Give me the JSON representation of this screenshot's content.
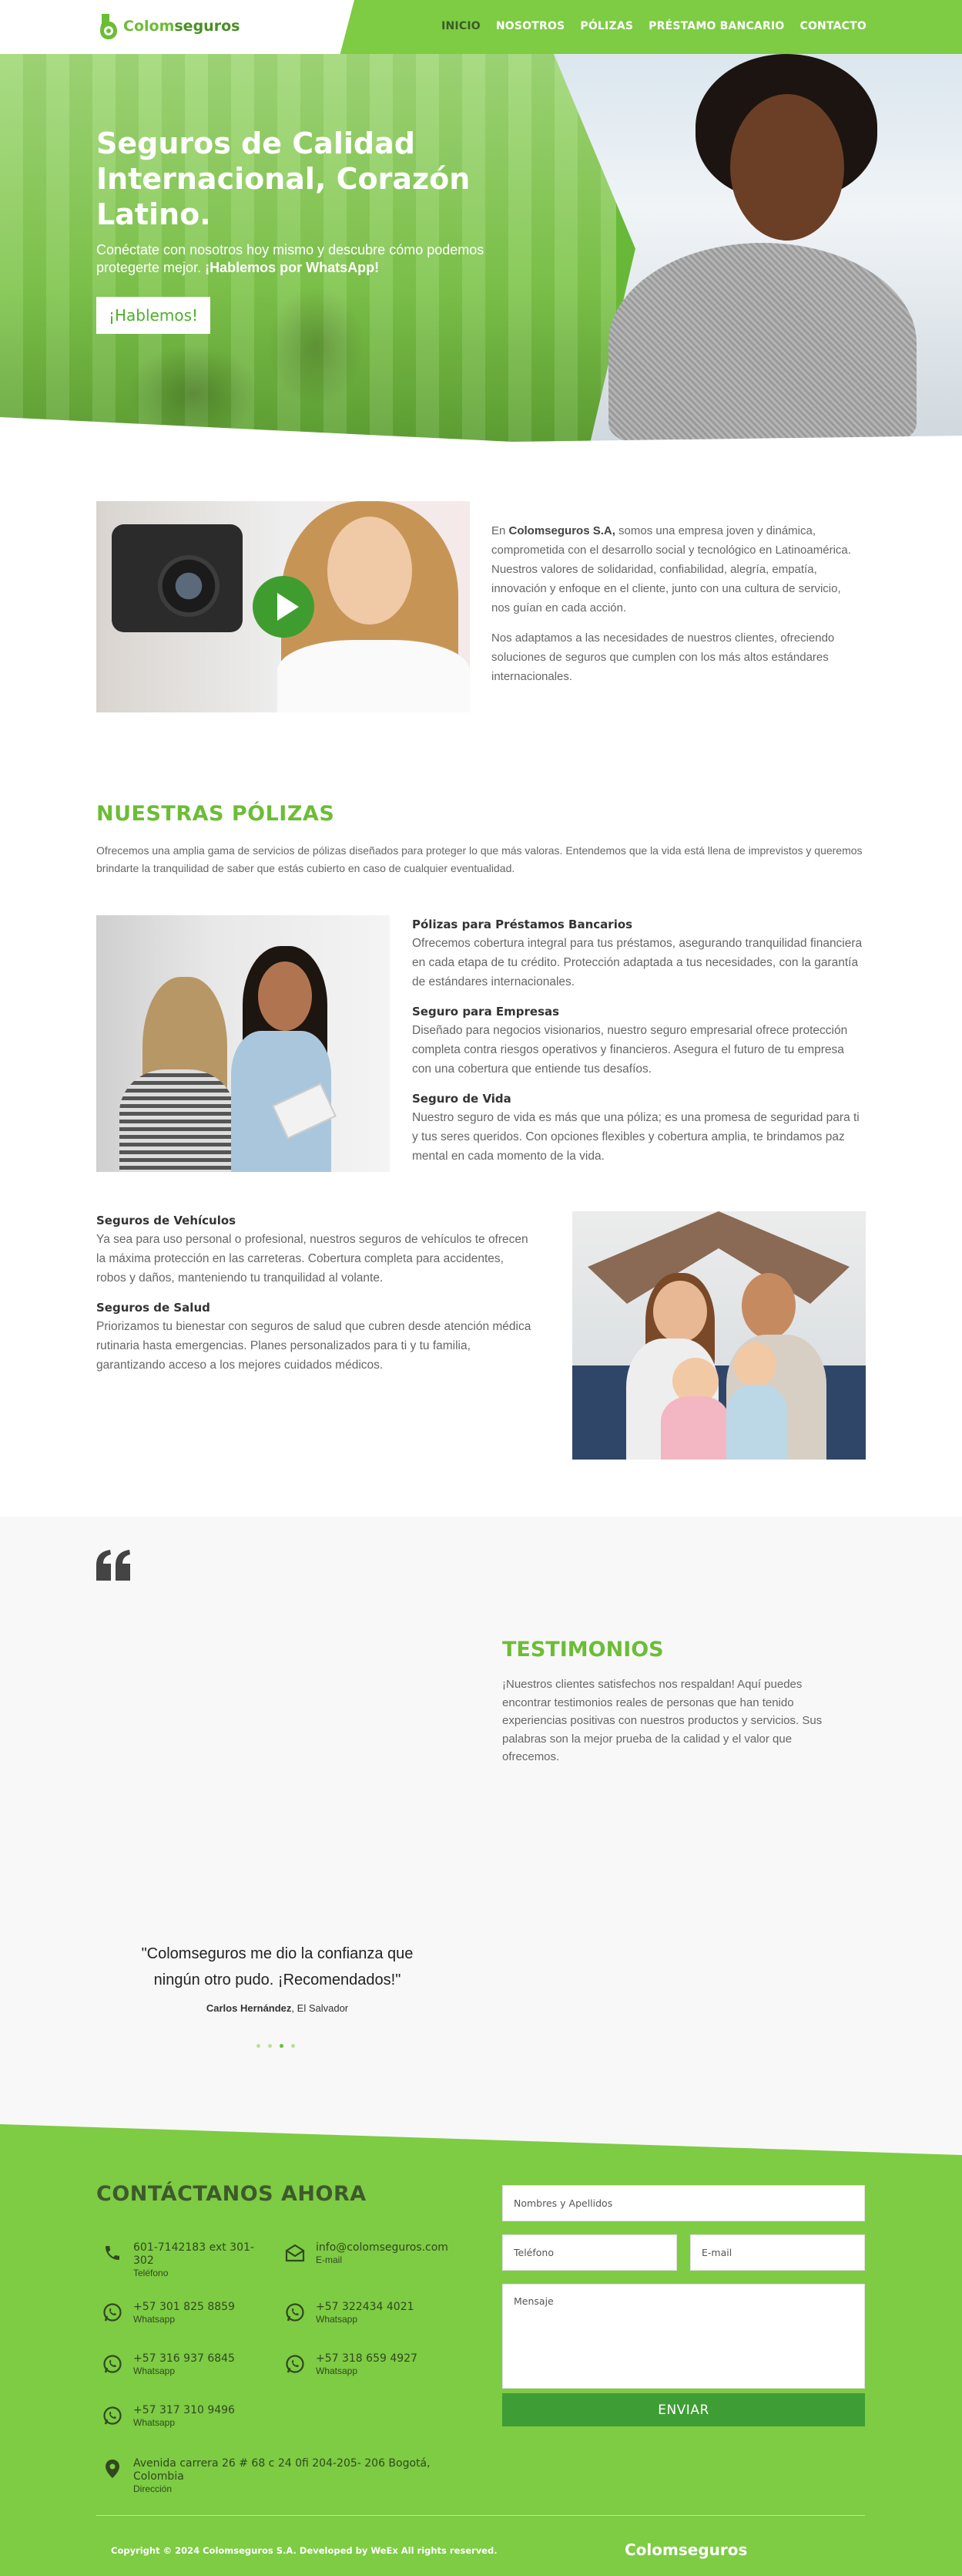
{
  "nav": {
    "logo_part1": "Colom",
    "logo_part2": "seguros",
    "items": [
      {
        "label": "INICIO"
      },
      {
        "label": "NOSOTROS"
      },
      {
        "label": "PÓLIZAS"
      },
      {
        "label": "PRÉSTAMO BANCARIO"
      },
      {
        "label": "CONTACTO"
      }
    ]
  },
  "hero": {
    "title": "Seguros de Calidad Internacional, Corazón Latino.",
    "subtitle": "Conéctate con nosotros hoy mismo y descubre cómo podemos protegerte mejor.",
    "subtitle_bold": "¡Hablemos por WhatsApp!",
    "cta": "¡Hablemos!"
  },
  "about": {
    "p1_prefix": "En ",
    "p1_company": "Colomseguros S.A,",
    "p1_rest": " somos una empresa joven y dinámica, comprometida con el desarrollo social y tecnológico en Latinoamérica. Nuestros valores de solidaridad, confiabilidad, alegría, empatía, innovación y enfoque en el cliente, junto con una cultura de servicio, nos guían en cada acción.",
    "p2": "Nos adaptamos a las necesidades de nuestros clientes, ofreciendo soluciones de seguros que cumplen con los más altos estándares internacionales."
  },
  "policies": {
    "title": "NUESTRAS PÓLIZAS",
    "intro": "Ofrecemos una amplia gama de servicios de pólizas diseñados para proteger lo que más valoras. Entendemos que la vida está llena de imprevistos y queremos brindarte la tranquilidad de saber que estás cubierto en caso de cualquier eventualidad.",
    "right": [
      {
        "title": "Pólizas para Préstamos Bancarios",
        "text": "Ofrecemos cobertura integral para tus préstamos, asegurando tranquilidad financiera en cada etapa de tu crédito. Protección adaptada a tus necesidades, con la garantía de estándares internacionales."
      },
      {
        "title": "Seguro para Empresas",
        "text": "Diseñado para negocios visionarios, nuestro seguro empresarial ofrece protección completa contra riesgos operativos y financieros. Asegura el futuro de tu empresa con una cobertura que entiende tus desafíos."
      },
      {
        "title": "Seguro de Vida",
        "text": "Nuestro seguro de vida es más que una póliza; es una promesa de seguridad para ti y tus seres queridos. Con opciones flexibles y cobertura amplia, te brindamos paz mental en cada momento de la vida."
      }
    ],
    "left": [
      {
        "title": "Seguros de Vehículos",
        "text": "Ya sea para uso personal o profesional, nuestros seguros de vehículos te ofrecen la máxima protección en las carreteras. Cobertura completa para accidentes, robos y daños, manteniendo tu tranquilidad al volante."
      },
      {
        "title": "Seguros de Salud",
        "text": "Priorizamos tu bienestar con seguros de salud que cubren desde atención médica rutinaria hasta emergencias. Planes personalizados para ti y tu familia, garantizando acceso a los mejores cuidados médicos."
      }
    ]
  },
  "testimonials": {
    "title": "TESTIMONIOS",
    "description": "¡Nuestros clientes satisfechos nos respaldan! Aquí puedes encontrar testimonios reales de personas que han tenido experiencias positivas con nuestros productos y servicios. Sus palabras son la mejor prueba de la calidad y el valor que ofrecemos.",
    "quote": "\"Colomseguros me dio la confianza que ningún otro pudo. ¡Recomendados!\"",
    "author": "Carlos Hernández",
    "location": ", El Salvador",
    "active_slide": 3,
    "slide_count": 4
  },
  "contact": {
    "title": "CONTÁCTANOS AHORA",
    "items": [
      {
        "icon": "phone-icon",
        "value": "601-7142183 ext 301-302",
        "label": "Teléfono"
      },
      {
        "icon": "mail-icon",
        "value": "info@colomseguros.com",
        "label": "E-mail"
      },
      {
        "icon": "whatsapp-icon",
        "value": "+57 301 825 8859",
        "label": "Whatsapp"
      },
      {
        "icon": "whatsapp-icon",
        "value": "+57 322434 4021",
        "label": "Whatsapp"
      },
      {
        "icon": "whatsapp-icon",
        "value": "+57 316 937 6845",
        "label": "Whatsapp"
      },
      {
        "icon": "whatsapp-icon",
        "value": "+57 318 659 4927",
        "label": "Whatsapp"
      },
      {
        "icon": "whatsapp-icon",
        "value": "+57 317 310 9496",
        "label": "Whatsapp"
      },
      {
        "icon": "location-pin-icon",
        "value": "Avenida carrera 26 # 68 c 24 0fi 204-205- 206 Bogotá, Colombia",
        "label": "Dirección"
      }
    ],
    "form": {
      "name_placeholder": "Nombres y Apellidos",
      "phone_placeholder": "Teléfono",
      "email_placeholder": "E-mail",
      "message_placeholder": "Mensaje",
      "submit": "ENVIAR"
    }
  },
  "footer": {
    "copyright": "Copyright © 2024 Colomseguros S.A. Developed by WeEx All rights reserved.",
    "brand": "Colomseguros"
  },
  "colors": {
    "brand_green": "#7ecb44",
    "title_green": "#6cbd36",
    "button_green": "#3f9d35"
  }
}
